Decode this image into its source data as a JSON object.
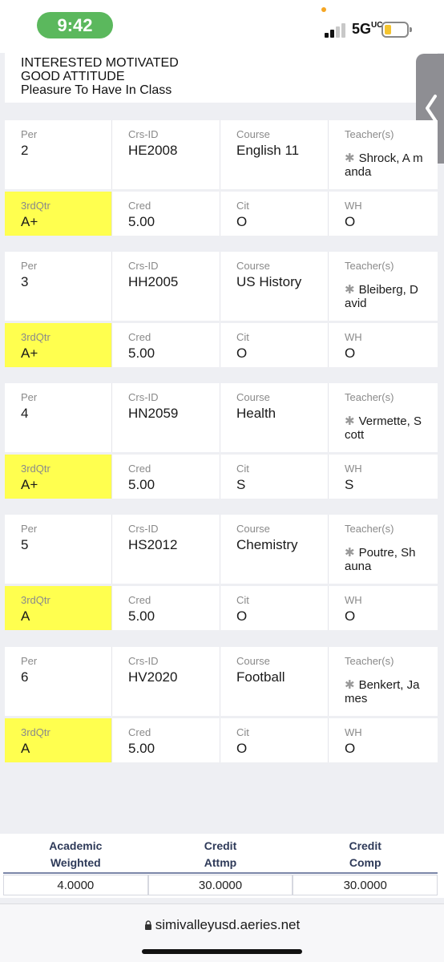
{
  "status": {
    "time": "9:42",
    "network": "5G",
    "network_suffix": "UC"
  },
  "comment": {
    "line1": "INTERESTED MOTIVATED",
    "line2": "GOOD ATTITUDE",
    "line3": "Pleasure To Have In Class"
  },
  "labels": {
    "per": "Per",
    "crs_id": "Crs-ID",
    "course": "Course",
    "teacher": "Teacher(s)",
    "mark": "3rdQtr",
    "cred": "Cred",
    "cit": "Cit",
    "wh": "WH"
  },
  "courses": [
    {
      "per": "2",
      "crs_id": "HE2008",
      "course": "English 11",
      "teacher": "Shrock, A manda",
      "mark": "A+",
      "cred": "5.00",
      "cit": "O",
      "wh": "O"
    },
    {
      "per": "3",
      "crs_id": "HH2005",
      "course": "US History",
      "teacher": "Bleiberg, D avid",
      "mark": "A+",
      "cred": "5.00",
      "cit": "O",
      "wh": "O"
    },
    {
      "per": "4",
      "crs_id": "HN2059",
      "course": "Health",
      "teacher": "Vermette, Scott",
      "mark": "A+",
      "cred": "5.00",
      "cit": "S",
      "wh": "S"
    },
    {
      "per": "5",
      "crs_id": "HS2012",
      "course": "Chemistry",
      "teacher": "Poutre, Sh auna",
      "mark": "A",
      "cred": "5.00",
      "cit": "O",
      "wh": "O"
    },
    {
      "per": "6",
      "crs_id": "HV2020",
      "course": "Football",
      "teacher": "Benkert, Ja mes",
      "mark": "A",
      "cred": "5.00",
      "cit": "O",
      "wh": "O"
    }
  ],
  "summary": {
    "headers": [
      {
        "line1": "Academic",
        "line2": "Weighted"
      },
      {
        "line1": "Credit",
        "line2": "Attmp"
      },
      {
        "line1": "Credit",
        "line2": "Comp"
      }
    ],
    "values": [
      "4.0000",
      "30.0000",
      "30.0000"
    ]
  },
  "browser": {
    "url": "simivalleyusd.aeries.net"
  },
  "colors": {
    "highlight": "#ffff4f",
    "time_pill": "#5bb85d",
    "header_text": "#2e3a59"
  }
}
